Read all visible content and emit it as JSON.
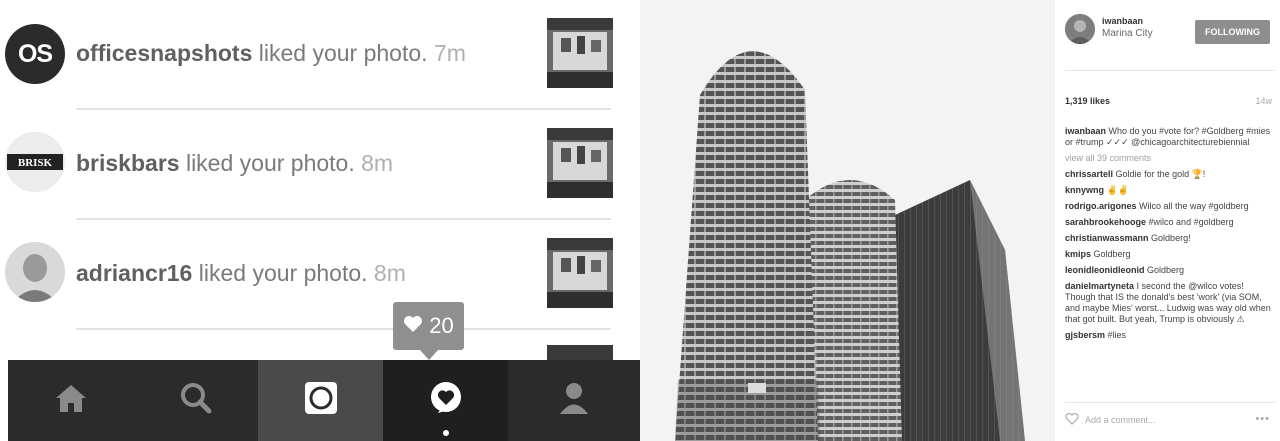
{
  "notifications": [
    {
      "username": "officesnapshots",
      "action": "liked your photo.",
      "ago": "7m",
      "avatar_text": "OS"
    },
    {
      "username": "briskbars",
      "action": "liked your photo.",
      "ago": "8m",
      "avatar_text": "BRISK"
    },
    {
      "username": "adriancr16",
      "action": "liked your photo.",
      "ago": "8m",
      "avatar_text": ""
    }
  ],
  "activity_tooltip": {
    "count": "20",
    "icon": "heart-icon"
  },
  "tabbar": {
    "tabs": [
      {
        "name": "home",
        "icon": "home-icon"
      },
      {
        "name": "search",
        "icon": "search-icon"
      },
      {
        "name": "camera",
        "icon": "camera-icon"
      },
      {
        "name": "activity",
        "icon": "activity-heart-icon"
      },
      {
        "name": "profile",
        "icon": "profile-icon"
      }
    ]
  },
  "post": {
    "username": "iwanbaan",
    "location": "Marina City",
    "follow_label": "FOLLOWING",
    "likes": "1,319 likes",
    "age": "14w",
    "caption_user": "iwanbaan",
    "caption_text": "Who do you #vote for? #Goldberg #mies or #trump ✓✓✓ @chicagoarchitecturebiennial",
    "view_all": "view all 39 comments",
    "comments": [
      {
        "user": "chrissartell",
        "text": "Goldie for the gold 🏆!"
      },
      {
        "user": "knnywng",
        "text": "✌✌"
      },
      {
        "user": "rodrigo.arigones",
        "text": "Wilco all the way #goldberg"
      },
      {
        "user": "sarahbrookehooge",
        "text": "#wilco and #goldberg"
      },
      {
        "user": "christianwassmann",
        "text": "Goldberg!"
      },
      {
        "user": "kmips",
        "text": "Goldberg"
      },
      {
        "user": "leonidleonidleonid",
        "text": "Goldberg"
      },
      {
        "user": "danielmartyneta",
        "text": "I second the @wilco votes! Though that IS the donald's best 'work' (via SOM, and maybe Mies' worst... Ludwig was way old when that got built. But yeah, Trump is obviously ⚠"
      },
      {
        "user": "gjsbersm",
        "text": "#lies"
      }
    ],
    "add_comment_placeholder": "Add a comment...",
    "more_label": "•••"
  },
  "colors": {
    "tabbar": "#2b2b2b",
    "tab_active": "#1f1f1f",
    "tooltip": "#8f8f8f",
    "follow_button": "#8e8e8e"
  }
}
